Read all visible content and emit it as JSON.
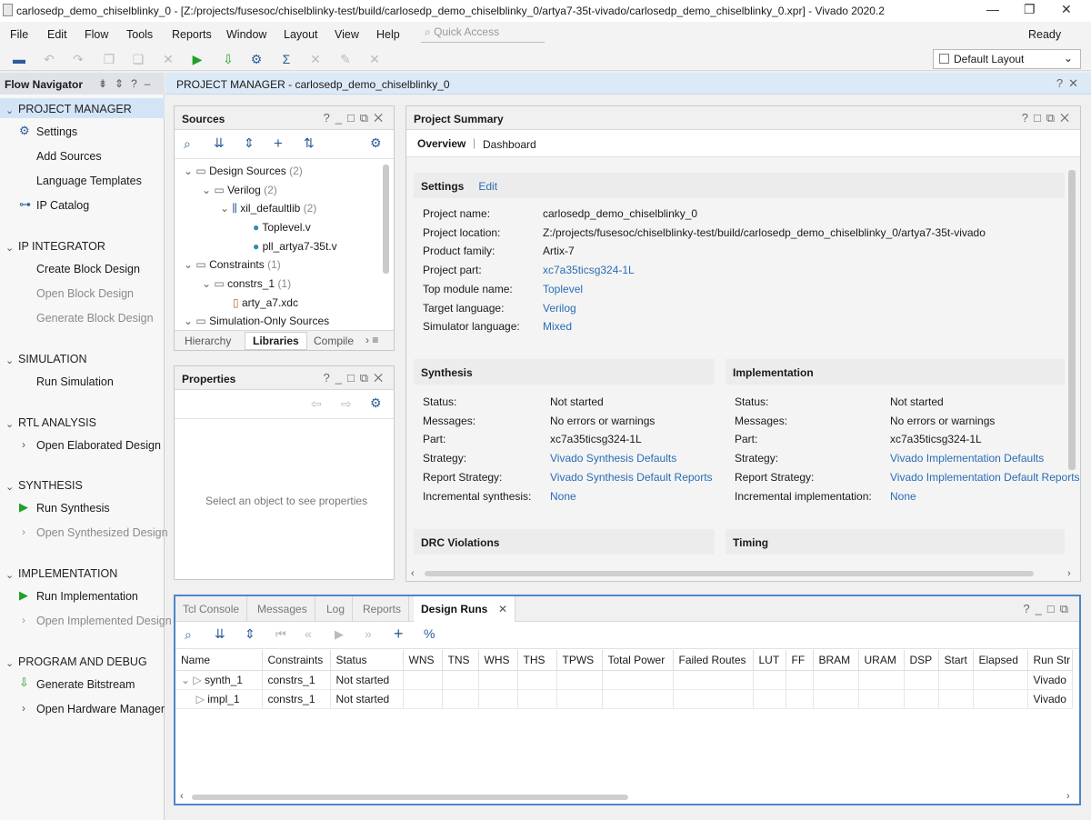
{
  "window": {
    "title": "carlosedp_demo_chiselblinky_0 - [Z:/projects/fusesoc/chiselblinky-test/build/carlosedp_demo_chiselblinky_0/artya7-35t-vivado/carlosedp_demo_chiselblinky_0.xpr] - Vivado 2020.2",
    "status": "Ready"
  },
  "menu": [
    "File",
    "Edit",
    "Flow",
    "Tools",
    "Reports",
    "Window",
    "Layout",
    "View",
    "Help"
  ],
  "quick_access": "Quick Access",
  "layout_select": "Default Layout",
  "flow_nav": {
    "title": "Flow Navigator",
    "project_manager": "PROJECT MANAGER",
    "settings": "Settings",
    "add_sources": "Add Sources",
    "language_templates": "Language Templates",
    "ip_catalog": "IP Catalog",
    "ip_integrator": "IP INTEGRATOR",
    "create_block": "Create Block Design",
    "open_block": "Open Block Design",
    "generate_block": "Generate Block Design",
    "simulation": "SIMULATION",
    "run_simulation": "Run Simulation",
    "rtl_analysis": "RTL ANALYSIS",
    "open_elaborated": "Open Elaborated Design",
    "synthesis": "SYNTHESIS",
    "run_synthesis": "Run Synthesis",
    "open_synthesized": "Open Synthesized Design",
    "implementation": "IMPLEMENTATION",
    "run_implementation": "Run Implementation",
    "open_implemented": "Open Implemented Design",
    "program_debug": "PROGRAM AND DEBUG",
    "generate_bitstream": "Generate Bitstream",
    "open_hw_manager": "Open Hardware Manager"
  },
  "pm_header": "PROJECT MANAGER - carlosedp_demo_chiselblinky_0",
  "sources": {
    "title": "Sources",
    "design_sources": "Design Sources",
    "design_sources_count": "(2)",
    "verilog": "Verilog",
    "verilog_count": "(2)",
    "lib": "xil_defaultlib",
    "lib_count": "(2)",
    "file1": "Toplevel.v",
    "file2": "pll_artya7-35t.v",
    "constraints": "Constraints",
    "constraints_count": "(1)",
    "constrs": "constrs_1",
    "constrs_count": "(1)",
    "xdc": "arty_a7.xdc",
    "sim_sources": "Simulation-Only Sources",
    "tabs": [
      "Hierarchy",
      "Libraries",
      "Compile"
    ]
  },
  "properties": {
    "title": "Properties",
    "empty": "Select an object to see properties"
  },
  "summary": {
    "title": "Project Summary",
    "tab_overview": "Overview",
    "tab_dashboard": "Dashboard",
    "settings_title": "Settings",
    "edit": "Edit",
    "settings": [
      {
        "k": "Project name:",
        "v": "carlosedp_demo_chiselblinky_0",
        "link": false
      },
      {
        "k": "Project location:",
        "v": "Z:/projects/fusesoc/chiselblinky-test/build/carlosedp_demo_chiselblinky_0/artya7-35t-vivado",
        "link": false
      },
      {
        "k": "Product family:",
        "v": "Artix-7",
        "link": false
      },
      {
        "k": "Project part:",
        "v": "xc7a35ticsg324-1L",
        "link": true
      },
      {
        "k": "Top module name:",
        "v": "Toplevel",
        "link": true
      },
      {
        "k": "Target language:",
        "v": "Verilog",
        "link": true
      },
      {
        "k": "Simulator language:",
        "v": "Mixed",
        "link": true
      }
    ],
    "synthesis_title": "Synthesis",
    "synthesis": [
      {
        "k": "Status:",
        "v": "Not started",
        "link": false
      },
      {
        "k": "Messages:",
        "v": "No errors or warnings",
        "link": false
      },
      {
        "k": "Part:",
        "v": "xc7a35ticsg324-1L",
        "link": false
      },
      {
        "k": "Strategy:",
        "v": "Vivado Synthesis Defaults",
        "link": true
      },
      {
        "k": "Report Strategy:",
        "v": "Vivado Synthesis Default Reports",
        "link": true
      },
      {
        "k": "Incremental synthesis:",
        "v": "None",
        "link": true
      }
    ],
    "implementation_title": "Implementation",
    "implementation": [
      {
        "k": "Status:",
        "v": "Not started",
        "link": false
      },
      {
        "k": "Messages:",
        "v": "No errors or warnings",
        "link": false
      },
      {
        "k": "Part:",
        "v": "xc7a35ticsg324-1L",
        "link": false
      },
      {
        "k": "Strategy:",
        "v": "Vivado Implementation Defaults",
        "link": true
      },
      {
        "k": "Report Strategy:",
        "v": "Vivado Implementation Default Reports",
        "link": true
      },
      {
        "k": "Incremental implementation:",
        "v": "None",
        "link": true
      }
    ],
    "drc_title": "DRC Violations",
    "timing_title": "Timing"
  },
  "bottom": {
    "tabs": [
      "Tcl Console",
      "Messages",
      "Log",
      "Reports",
      "Design Runs"
    ],
    "columns": [
      "Name",
      "Constraints",
      "Status",
      "WNS",
      "TNS",
      "WHS",
      "THS",
      "TPWS",
      "Total Power",
      "Failed Routes",
      "LUT",
      "FF",
      "BRAM",
      "URAM",
      "DSP",
      "Start",
      "Elapsed",
      "Run Str"
    ],
    "rows": [
      {
        "name": "synth_1",
        "constraints": "constrs_1",
        "status": "Not started",
        "run": "Vivado"
      },
      {
        "name": "impl_1",
        "constraints": "constrs_1",
        "status": "Not started",
        "run": "Vivado"
      }
    ]
  }
}
